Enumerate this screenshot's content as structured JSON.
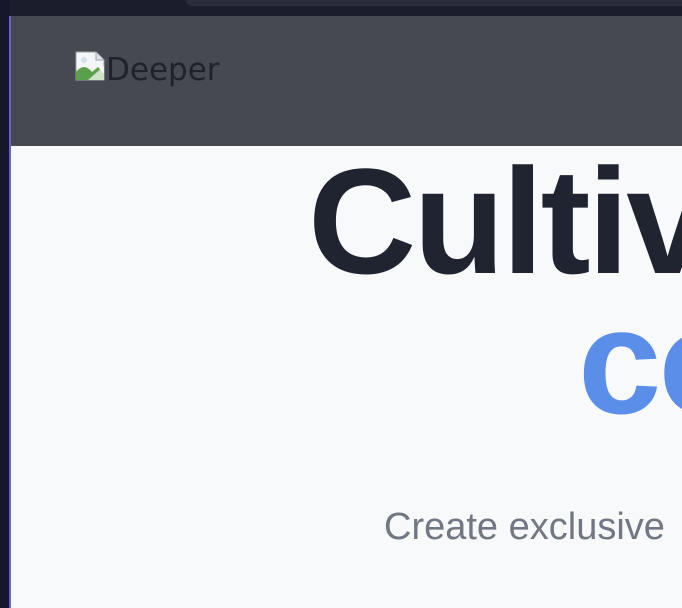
{
  "header": {
    "logo_alt": "Deeper"
  },
  "hero": {
    "title_line1": "Cultiv",
    "title_line2": "co",
    "subtitle": "Create exclusive"
  },
  "colors": {
    "header_bg": "#464a50",
    "page_bg": "#f8f9fb",
    "title": "#1f2430",
    "accent": "#5b8ee8",
    "subtitle": "#717884",
    "window_edge": "#6b5fd6"
  },
  "icons": {
    "logo_image": "broken-image-icon"
  }
}
